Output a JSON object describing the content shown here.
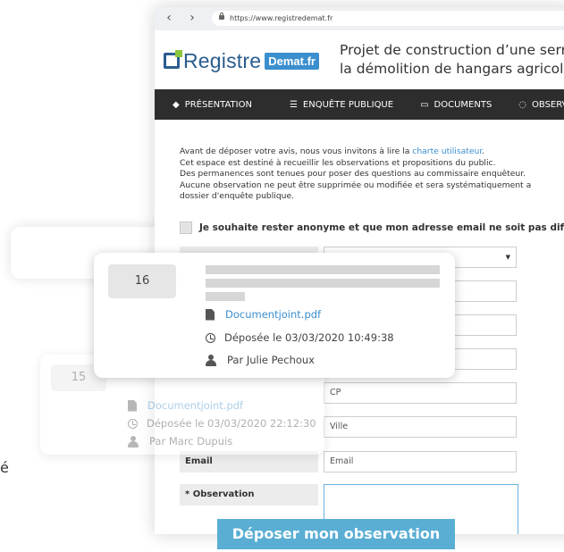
{
  "browser": {
    "back": "‹",
    "forward": "›",
    "url": "https://www.registredemat.fr"
  },
  "site": {
    "logo_text": "Registre",
    "logo_badge": "Demat.fr",
    "project_title_line1": "Projet de construction d’une serre r",
    "project_title_line2": "la démolition de hangars agricoles"
  },
  "menu": [
    {
      "icon": "◆",
      "label": "PRÉSENTATION"
    },
    {
      "icon": "☰",
      "label": "ENQUÊTE PUBLIQUE"
    },
    {
      "icon": "▭",
      "label": "DOCUMENTS"
    },
    {
      "icon": "◌",
      "label": "OBSERVATIO"
    }
  ],
  "intro": {
    "line1_before": "Avant de déposer votre avis, nous vous invitons à lire la ",
    "line1_link": "charte utilisateur",
    "line1_after": ".",
    "line2": "Cet espace est destiné à recueillir les observations et propositions du public.",
    "line3": "Des permanences sont tenues pour poser des questions au commissaire enquêteur.",
    "line4": "Aucune observation ne peut être supprimée ou modifiée et sera systématiquement a",
    "line5": "dossier d'enquête publique."
  },
  "anonymous_label": "Je souhaite rester anonyme et que mon adresse email ne soit pas diffusée.",
  "form": {
    "cp_placeholder": "CP",
    "ville_placeholder": "Ville",
    "email_label": "Email",
    "email_placeholder": "Email",
    "observation_label": "* Observation"
  },
  "submit_label": "Déposer mon observation",
  "cards": [
    {
      "number": "16",
      "document": "Documentjoint.pdf",
      "date": "Déposée le 03/03/2020 10:49:38",
      "author": "Par Julie Pechoux"
    },
    {
      "number": "15",
      "document": "Documentjoint.pdf",
      "date": "Déposée le 03/03/2020 22:12:30",
      "author": "Par Marc Dupuis"
    }
  ],
  "stray_char": "é"
}
